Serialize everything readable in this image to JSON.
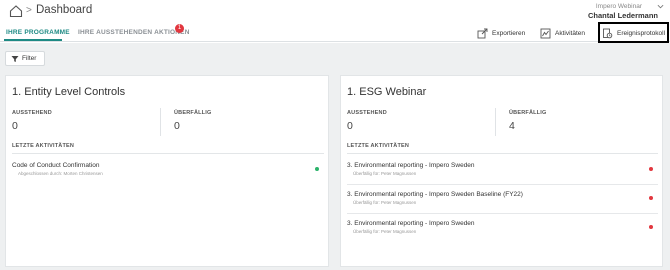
{
  "header": {
    "breadcrumb_sep": ">",
    "title": "Dashboard",
    "org": "Impero Webinar",
    "user": "Chantal Ledermann"
  },
  "tabs": {
    "programs": "IHRE PROGRAMME",
    "actions": "IHRE AUSSTEHENDEN AKTIONEN",
    "actions_badge": "1"
  },
  "toolbar": {
    "export": "Exportieren",
    "activity": "Aktivitäten",
    "log": "Ereignisprotokoll"
  },
  "filter": {
    "label": "Filter"
  },
  "colors": {
    "accent": "#1e8a84",
    "ok": "#2bb36a",
    "overdue": "#e2373f"
  },
  "cards": [
    {
      "title": "1. Entity Level Controls",
      "pending_label": "AUSSTEHEND",
      "pending_value": "0",
      "overdue_label": "ÜBERFÄLLIG",
      "overdue_value": "0",
      "recent_label": "LETZTE AKTIVITÄTEN",
      "activities": [
        {
          "title": "Code of Conduct Confirmation",
          "sub": "Abgeschlossen durch: Morten Christensen",
          "status": "ok"
        }
      ]
    },
    {
      "title": "1. ESG Webinar",
      "pending_label": "AUSSTEHEND",
      "pending_value": "0",
      "overdue_label": "ÜBERFÄLLIG",
      "overdue_value": "4",
      "recent_label": "LETZTE AKTIVITÄTEN",
      "activities": [
        {
          "title": "3. Environmental reporting - Impero Sweden",
          "sub": "Überfällig für: Peter Magnussen",
          "status": "overdue"
        },
        {
          "title": "3. Environmental reporting - Impero Sweden Baseline (FY22)",
          "sub": "Überfällig für: Peter Magnussen",
          "status": "overdue"
        },
        {
          "title": "3. Environmental reporting - Impero Sweden",
          "sub": "Überfällig für: Peter Magnussen",
          "status": "overdue"
        }
      ]
    }
  ]
}
